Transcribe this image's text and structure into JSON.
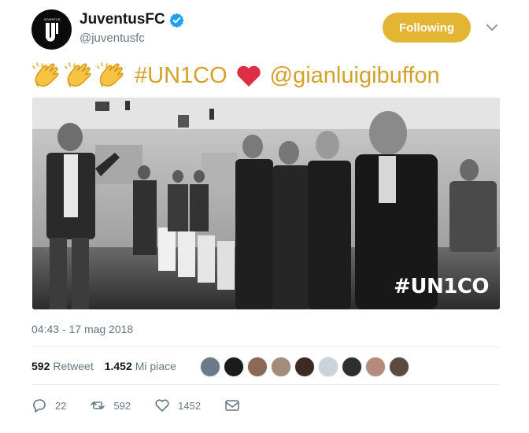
{
  "header": {
    "display_name": "JuventusFC",
    "handle": "@juventusfc",
    "follow_label": "Following",
    "avatar_icon": "juventus-logo",
    "verified_icon": "verified-badge"
  },
  "tweet": {
    "emoji": [
      "clapping-hands",
      "clapping-hands",
      "clapping-hands"
    ],
    "hashtag": "#UN1CO",
    "heart_icon": "red-heart",
    "mention": "@gianluigibuffon"
  },
  "photo": {
    "overlay_text": "#UN1CO"
  },
  "timestamp": "04:43 - 17 mag 2018",
  "stats": {
    "retweets_count": "592",
    "retweets_label": "Retweet",
    "likes_count": "1.452",
    "likes_label": "Mi piace"
  },
  "actions": {
    "reply_count": "22",
    "retweet_count": "592",
    "like_count": "1452"
  },
  "colors": {
    "accent": "#e2b533",
    "text_gold": "#d4a12b",
    "verified": "#1da1f2",
    "heart": "#e0245e"
  }
}
